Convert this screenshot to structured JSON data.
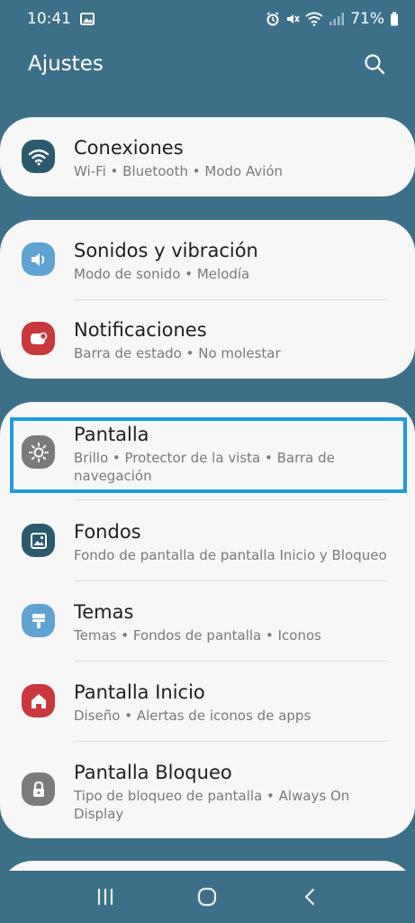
{
  "status": {
    "time": "10:41",
    "battery": "71%"
  },
  "header": {
    "title": "Ajustes"
  },
  "items": {
    "conexiones": {
      "title": "Conexiones",
      "subtitle": "Wi-Fi • Bluetooth • Modo Avión",
      "color": "#2b5a6e"
    },
    "sonidos": {
      "title": "Sonidos y vibración",
      "subtitle": "Modo de sonido • Melodía",
      "color": "#5fa3d3"
    },
    "notificaciones": {
      "title": "Notificaciones",
      "subtitle": "Barra de estado • No molestar",
      "color": "#c8383d"
    },
    "pantalla": {
      "title": "Pantalla",
      "subtitle": "Brillo • Protector de la vista • Barra de navegación",
      "color": "#7b7b7b"
    },
    "fondos": {
      "title": "Fondos",
      "subtitle": "Fondo de pantalla de pantalla Inicio y Bloqueo",
      "color": "#2b5a6e"
    },
    "temas": {
      "title": "Temas",
      "subtitle": "Temas • Fondos de pantalla • Iconos",
      "color": "#5fa3d3"
    },
    "inicio": {
      "title": "Pantalla Inicio",
      "subtitle": "Diseño • Alertas de iconos de apps",
      "color": "#c8383d"
    },
    "bloqueo": {
      "title": "Pantalla Bloqueo",
      "subtitle": "Tipo de bloqueo de pantalla • Always On Display",
      "color": "#7b7b7b"
    }
  },
  "highlight_color": "#1e9be0"
}
